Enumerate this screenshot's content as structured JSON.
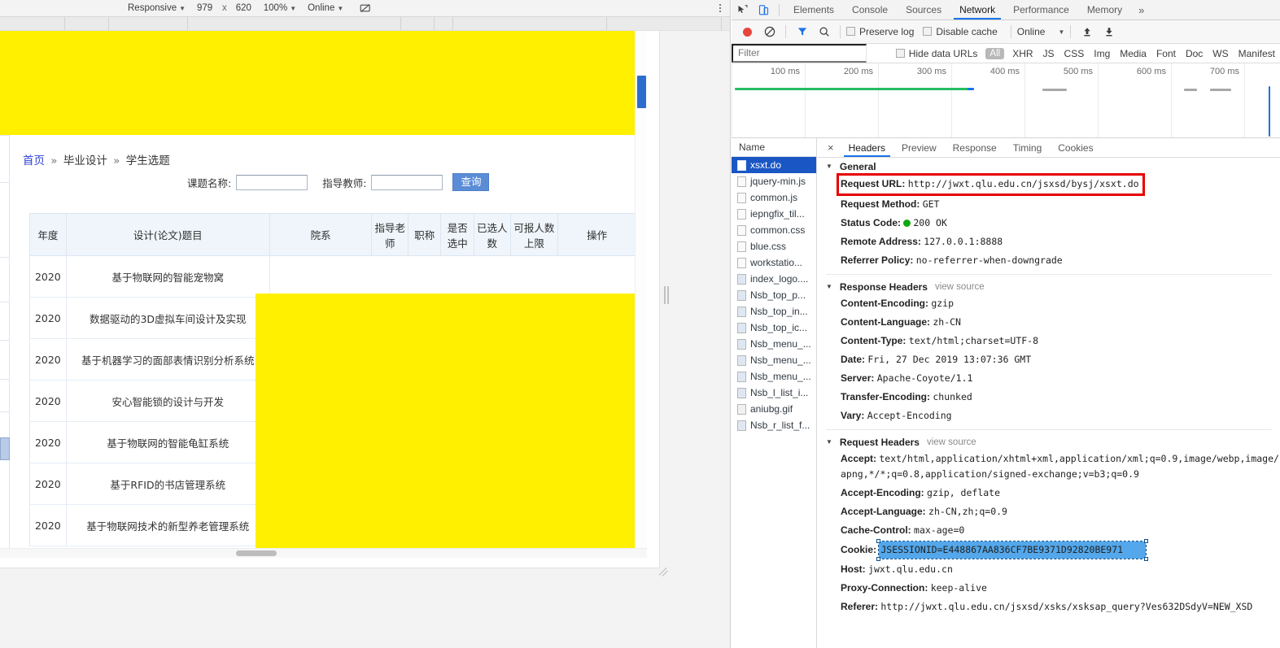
{
  "colors": {
    "highlight_yellow": "#fff000",
    "accent_blue": "#1a73e8",
    "selection_blue": "#1a56c4",
    "redaction_red": "#e60000",
    "status_green": "#11a711"
  },
  "device_toolbar": {
    "device_label": "Responsive",
    "width": "979",
    "height_label": "x",
    "height": "620",
    "zoom": "100%",
    "throttling": "Online",
    "rotate_icon": "rotate-icon",
    "menu_icon": "kebab-menu-icon"
  },
  "page": {
    "breadcrumb": {
      "home": "首页",
      "sep": "»",
      "section": "毕业设计",
      "current": "学生选题"
    },
    "query": {
      "topic_label": "课题名称:",
      "topic_value": "",
      "teacher_label": "指导教师:",
      "teacher_value": "",
      "search_button": "查询"
    },
    "table": {
      "headers": [
        "年度",
        "设计(论文)题目",
        "院系",
        "指导老师",
        "职称",
        "是否选中",
        "已选人数",
        "可报人数上限",
        "操作"
      ],
      "rows": [
        {
          "year": "2020",
          "title": "基于物联网的智能宠物窝"
        },
        {
          "year": "2020",
          "title": "数据驱动的3D虚拟车间设计及实现"
        },
        {
          "year": "2020",
          "title": "基于机器学习的面部表情识别分析系统"
        },
        {
          "year": "2020",
          "title": "安心智能锁的设计与开发"
        },
        {
          "year": "2020",
          "title": "基于物联网的智能龟缸系统"
        },
        {
          "year": "2020",
          "title": "基于RFID的书店管理系统"
        },
        {
          "year": "2020",
          "title": "基于物联网技术的新型养老管理系统"
        }
      ]
    }
  },
  "devtools": {
    "top_icons": [
      "inspect-element-icon",
      "device-toolbar-icon"
    ],
    "tabs": [
      {
        "label": "Elements",
        "active": false
      },
      {
        "label": "Console",
        "active": false
      },
      {
        "label": "Sources",
        "active": false
      },
      {
        "label": "Network",
        "active": true
      },
      {
        "label": "Performance",
        "active": false
      },
      {
        "label": "Memory",
        "active": false
      }
    ],
    "more_tabs": "»",
    "toolbar": {
      "record_icon": "record-button-icon",
      "clear_icon": "clear-icon",
      "filter_icon": "filter-funnel-icon",
      "search_icon": "search-icon",
      "preserve_log": "Preserve log",
      "disable_cache": "Disable cache",
      "throttling": "Online",
      "import_icon": "import-har-icon",
      "export_icon": "export-har-icon"
    },
    "filterbar": {
      "placeholder": "Filter",
      "value": "",
      "hide_data_urls": "Hide data URLs",
      "types": [
        "All",
        "XHR",
        "JS",
        "CSS",
        "Img",
        "Media",
        "Font",
        "Doc",
        "WS",
        "Manifest"
      ]
    },
    "overview": {
      "ticks": [
        "100 ms",
        "200 ms",
        "300 ms",
        "400 ms",
        "500 ms",
        "600 ms",
        "700 ms"
      ]
    },
    "requests": {
      "column_header": "Name",
      "items": [
        {
          "name": "xsxt.do",
          "selected": true,
          "kind": "doc"
        },
        {
          "name": "jquery-min.js",
          "selected": false,
          "kind": "script"
        },
        {
          "name": "common.js",
          "selected": false,
          "kind": "script"
        },
        {
          "name": "iepngfix_til...",
          "selected": false,
          "kind": "script"
        },
        {
          "name": "common.css",
          "selected": false,
          "kind": "style"
        },
        {
          "name": "blue.css",
          "selected": false,
          "kind": "style"
        },
        {
          "name": "workstatio...",
          "selected": false,
          "kind": "style"
        },
        {
          "name": "index_logo....",
          "selected": false,
          "kind": "img"
        },
        {
          "name": "Nsb_top_p...",
          "selected": false,
          "kind": "img"
        },
        {
          "name": "Nsb_top_in...",
          "selected": false,
          "kind": "img"
        },
        {
          "name": "Nsb_top_ic...",
          "selected": false,
          "kind": "img"
        },
        {
          "name": "Nsb_menu_...",
          "selected": false,
          "kind": "img"
        },
        {
          "name": "Nsb_menu_...",
          "selected": false,
          "kind": "img"
        },
        {
          "name": "Nsb_menu_...",
          "selected": false,
          "kind": "img"
        },
        {
          "name": "Nsb_l_list_i...",
          "selected": false,
          "kind": "img"
        },
        {
          "name": "aniubg.gif",
          "selected": false,
          "kind": "gif"
        },
        {
          "name": "Nsb_r_list_f...",
          "selected": false,
          "kind": "img"
        }
      ]
    },
    "detail": {
      "close_label": "×",
      "tabs": [
        {
          "label": "Headers",
          "active": true
        },
        {
          "label": "Preview",
          "active": false
        },
        {
          "label": "Response",
          "active": false
        },
        {
          "label": "Timing",
          "active": false
        },
        {
          "label": "Cookies",
          "active": false
        }
      ],
      "general": {
        "section_title": "General",
        "request_url_label": "Request URL:",
        "request_url_value": "http://jwxt.qlu.edu.cn/jsxsd/bysj/xsxt.do",
        "request_method_label": "Request Method:",
        "request_method_value": "GET",
        "status_code_label": "Status Code:",
        "status_code_value": "200 OK",
        "remote_address_label": "Remote Address:",
        "remote_address_value": "127.0.0.1:8888",
        "referrer_policy_label": "Referrer Policy:",
        "referrer_policy_value": "no-referrer-when-downgrade"
      },
      "response_headers": {
        "section_title": "Response Headers",
        "view_source": "view source",
        "rows": [
          {
            "name": "Content-Encoding:",
            "value": "gzip"
          },
          {
            "name": "Content-Language:",
            "value": "zh-CN"
          },
          {
            "name": "Content-Type:",
            "value": "text/html;charset=UTF-8"
          },
          {
            "name": "Date:",
            "value": "Fri, 27 Dec 2019 13:07:36 GMT"
          },
          {
            "name": "Server:",
            "value": "Apache-Coyote/1.1"
          },
          {
            "name": "Transfer-Encoding:",
            "value": "chunked"
          },
          {
            "name": "Vary:",
            "value": "Accept-Encoding"
          }
        ]
      },
      "request_headers": {
        "section_title": "Request Headers",
        "view_source": "view source",
        "accept_label": "Accept:",
        "accept_value": "text/html,application/xhtml+xml,application/xml;q=0.9,image/webp,image/apng,*/*;q=0.8,application/signed-exchange;v=b3;q=0.9",
        "rows": [
          {
            "name": "Accept-Encoding:",
            "value": "gzip, deflate"
          },
          {
            "name": "Accept-Language:",
            "value": "zh-CN,zh;q=0.9"
          },
          {
            "name": "Cache-Control:",
            "value": "max-age=0"
          }
        ],
        "cookie_label": "Cookie:",
        "cookie_value": "JSESSIONID=E448867AA836CF7BE9371D92820BE971",
        "host_label": "Host:",
        "host_value": "jwxt.qlu.edu.cn",
        "proxy_label": "Proxy-Connection:",
        "proxy_value": "keep-alive",
        "referer_label": "Referer:",
        "referer_value": "http://jwxt.qlu.edu.cn/jsxsd/xsks/xsksap_query?Ves632DSdyV=NEW_XSD"
      }
    }
  }
}
